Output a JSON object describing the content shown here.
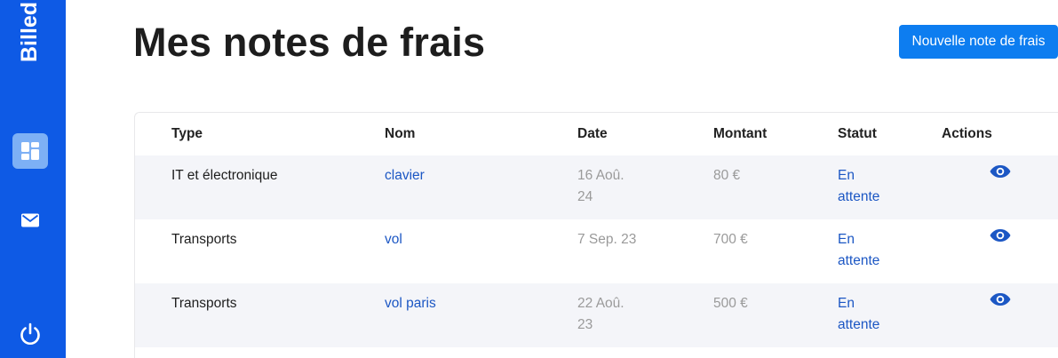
{
  "sidebar": {
    "brand": "Billed",
    "items": [
      {
        "name": "dashboard",
        "icon": "dashboard-icon",
        "active": true
      },
      {
        "name": "mail",
        "icon": "mail-icon",
        "active": false
      }
    ],
    "logout_icon": "power-icon"
  },
  "header": {
    "title": "Mes notes de frais",
    "new_button": "Nouvelle note de frais"
  },
  "table": {
    "columns": [
      "Type",
      "Nom",
      "Date",
      "Montant",
      "Statut",
      "Actions"
    ],
    "rows": [
      {
        "type": "IT et électronique",
        "name": "clavier",
        "date": "16 Aoû. 24",
        "amount": "80 €",
        "status": "En attente",
        "action_icon": "eye-icon"
      },
      {
        "type": "Transports",
        "name": "vol",
        "date": "7 Sep. 23",
        "amount": "700 €",
        "status": "En attente",
        "action_icon": "eye-icon"
      },
      {
        "type": "Transports",
        "name": "vol paris",
        "date": "22 Aoû. 23",
        "amount": "500 €",
        "status": "En attente",
        "action_icon": "eye-icon"
      }
    ]
  },
  "colors": {
    "sidebar": "#0e5ae5",
    "primary_button": "#0d7df0",
    "link": "#1c57c4",
    "row_stripe": "#f4f5f9"
  }
}
